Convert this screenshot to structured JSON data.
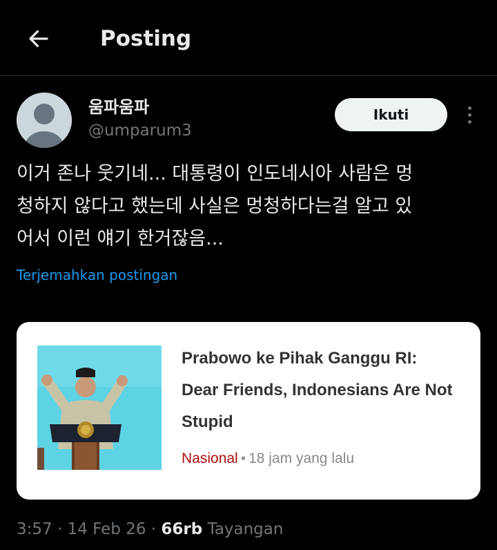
{
  "header": {
    "title": "Posting",
    "back_icon": "arrow-left-icon"
  },
  "post": {
    "display_name": "움파움파",
    "handle": "@umparum3",
    "follow_label": "Ikuti",
    "text": "이거 존나 웃기네... 대통령이 인도네시아 사람은 멍\n청하지 않다고 했는데 사실은 멍청하다는걸 알고 있\n어서 이런 얘기 한거잖음...",
    "translate_label": "Terjemahkan postingan",
    "time": "3:57",
    "date": "14 Feb 26",
    "separator": "·",
    "views_count": "66rb",
    "views_label": "Tayangan"
  },
  "card": {
    "title": "Prabowo ke Pihak Ganggu RI: Dear Friends, Indonesians Are Not Stupid",
    "category": "Nasional",
    "dot": "•",
    "time_ago": "18 jam yang lalu"
  },
  "colors": {
    "background": "#000000",
    "text": "#e7e9ea",
    "muted": "#71767b",
    "link": "#1d9bf0",
    "category": "#b10e0e",
    "thumbnail_bg": "#5ed3e4"
  }
}
